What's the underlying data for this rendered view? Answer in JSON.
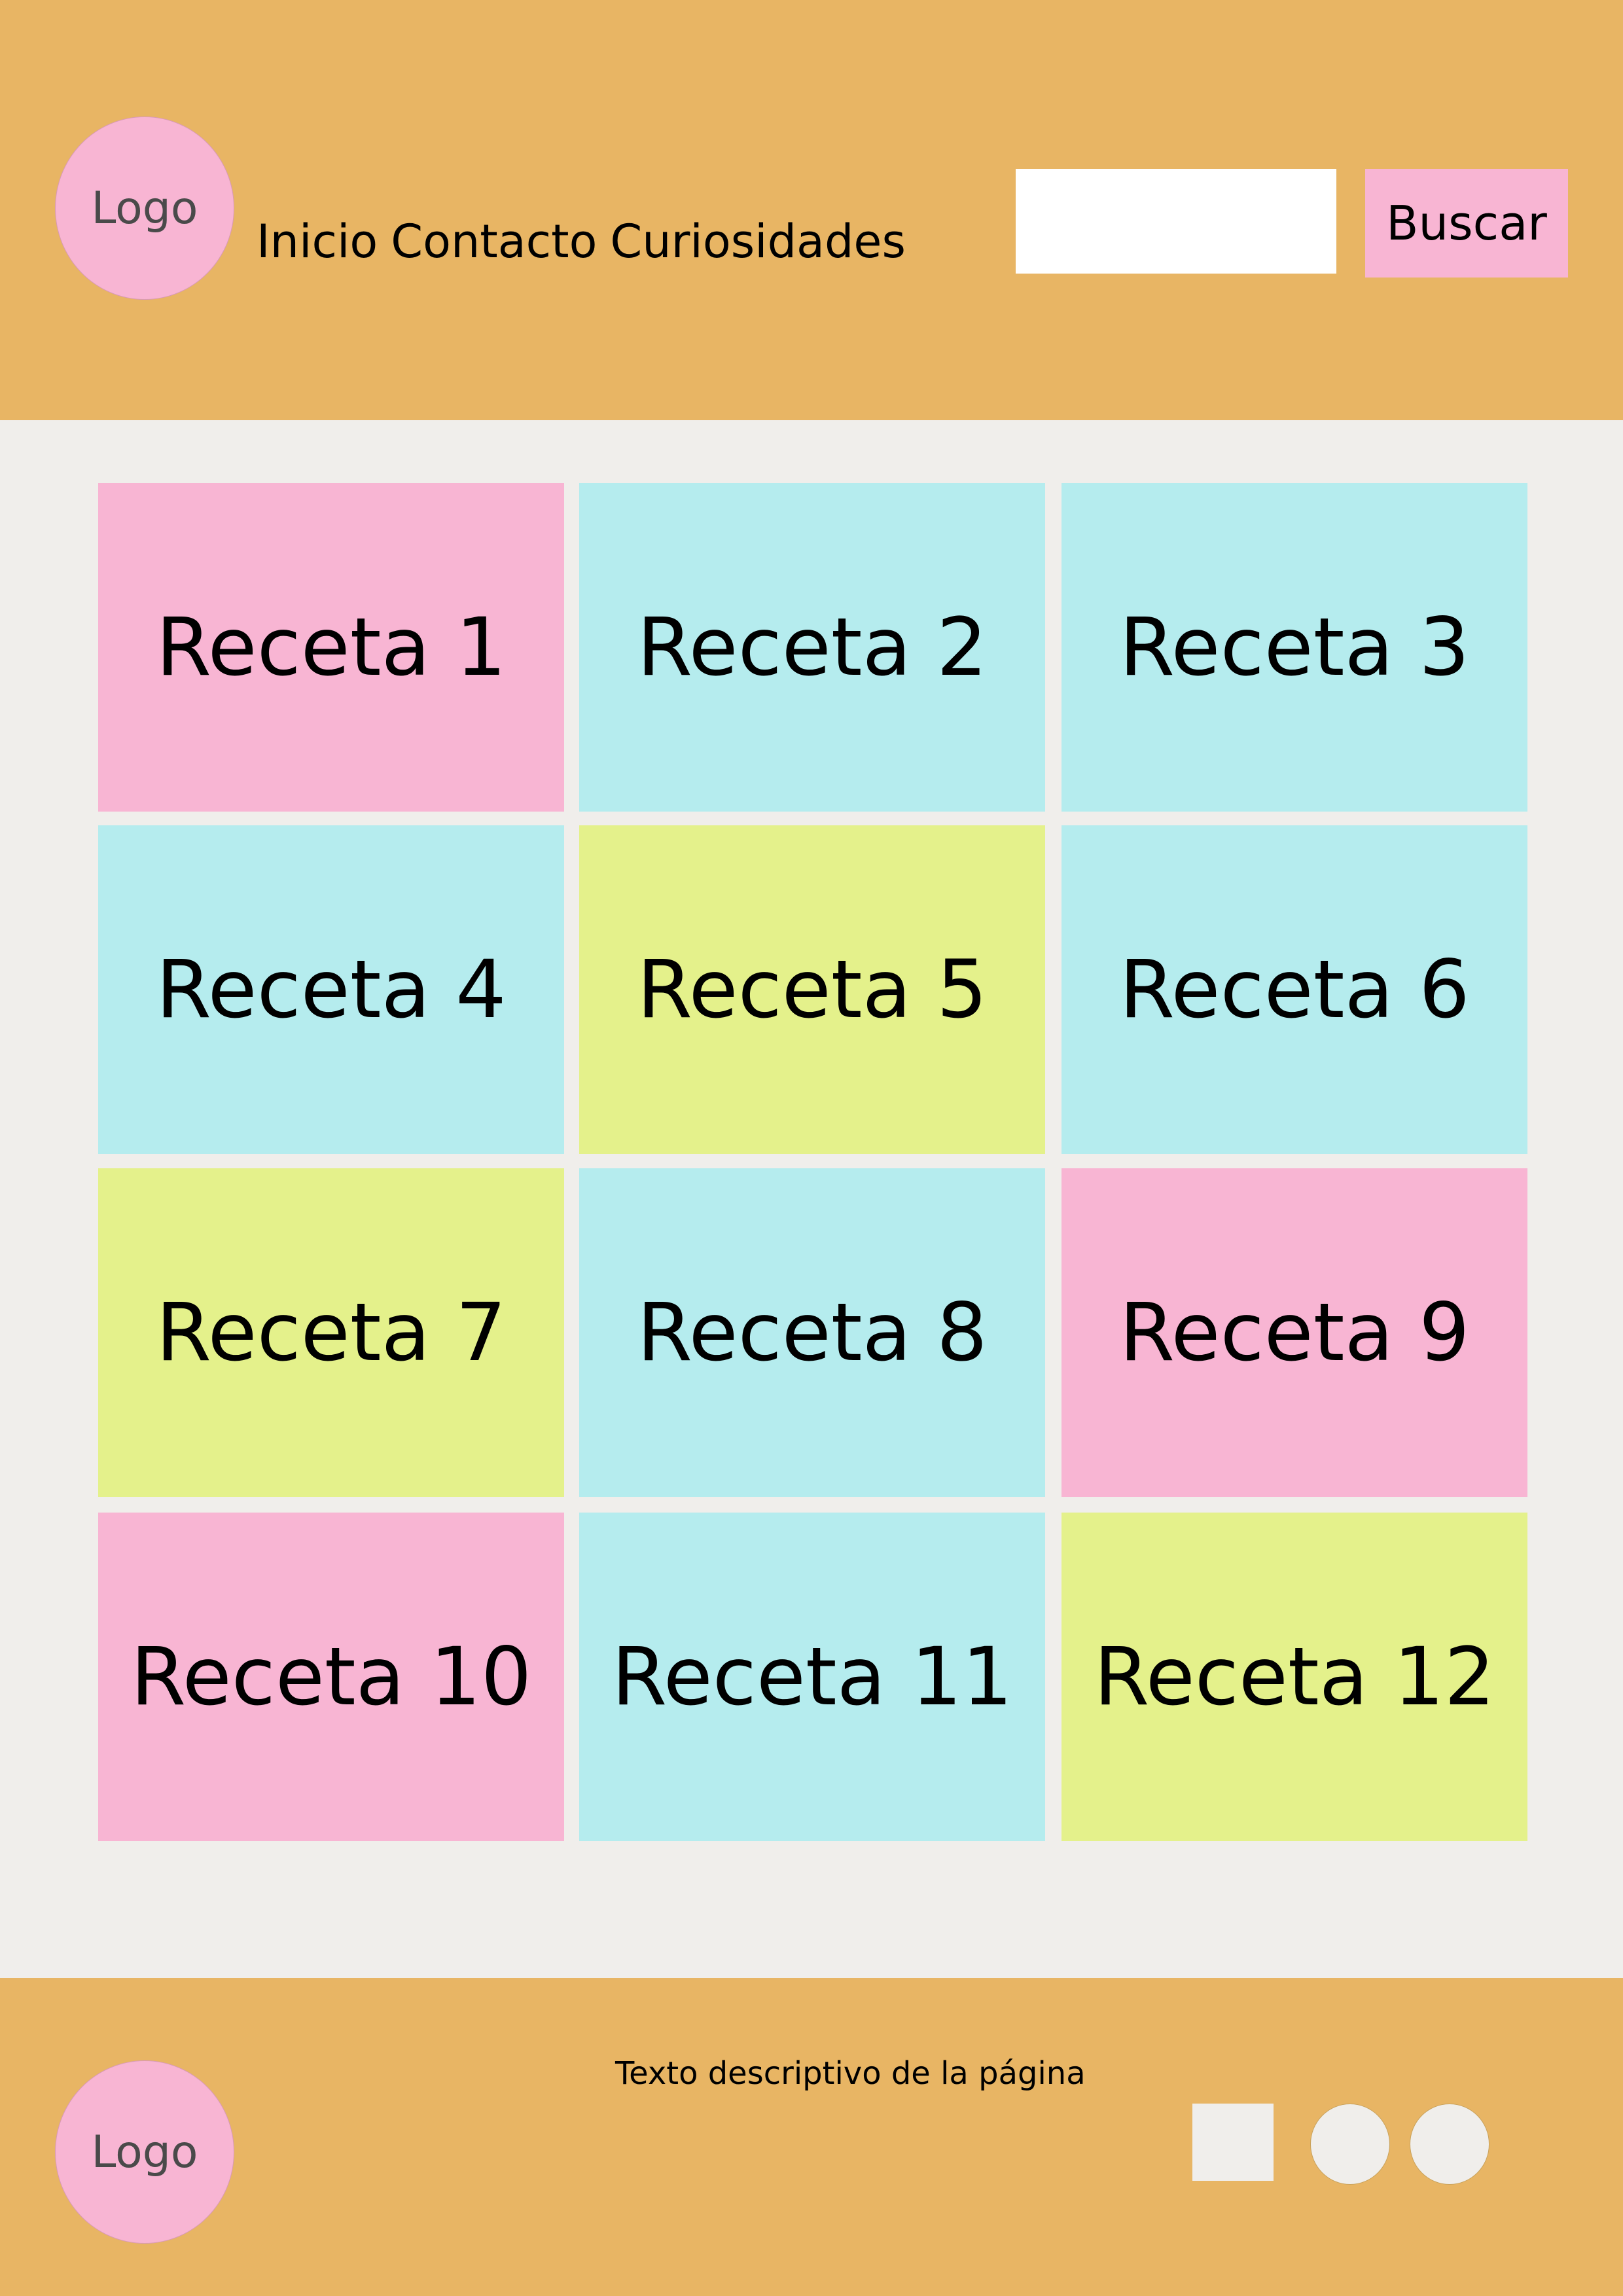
{
  "header": {
    "logo": "Logo",
    "nav": [
      "Inicio",
      "Contacto",
      "Curiosidades"
    ],
    "search": {
      "value": "",
      "placeholder": "",
      "button_label": "Buscar"
    }
  },
  "recipes": [
    {
      "label": "Receta 1",
      "color": "#f8b5d3"
    },
    {
      "label": "Receta 2",
      "color": "#b5ecee"
    },
    {
      "label": "Receta 3",
      "color": "#b5ecee"
    },
    {
      "label": "Receta 4",
      "color": "#b5ecee"
    },
    {
      "label": "Receta 5",
      "color": "#e4f18b"
    },
    {
      "label": "Receta 6",
      "color": "#b5ecee"
    },
    {
      "label": "Receta 7",
      "color": "#e4f18b"
    },
    {
      "label": "Receta 8",
      "color": "#b5ecee"
    },
    {
      "label": "Receta 9",
      "color": "#f8b5d3"
    },
    {
      "label": "Receta 10",
      "color": "#f8b5d3"
    },
    {
      "label": "Receta 11",
      "color": "#b5ecee"
    },
    {
      "label": "Receta 12",
      "color": "#e4f18b"
    }
  ],
  "footer": {
    "logo": "Logo",
    "description": "Texto descriptivo de la página"
  },
  "colors": {
    "header_bg": "#e8b564",
    "page_bg": "#f0eeeb",
    "accent_pink": "#f8b5d3",
    "accent_cyan": "#b5ecee",
    "accent_lime": "#e4f18b"
  }
}
